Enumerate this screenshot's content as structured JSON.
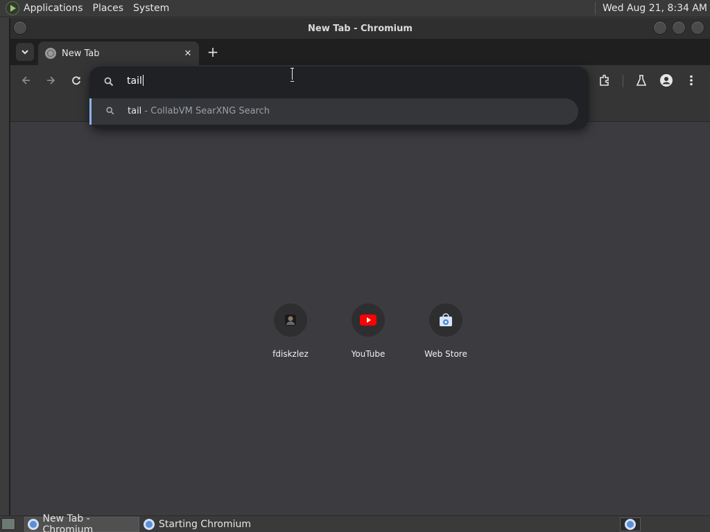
{
  "panel": {
    "menus": [
      "Applications",
      "Places",
      "System"
    ],
    "clock": "Wed Aug 21,  8:34 AM"
  },
  "window": {
    "title": "New Tab - Chromium"
  },
  "tabs": [
    {
      "title": "New Tab",
      "close": "✕"
    }
  ],
  "new_tab_symbol": "+",
  "omnibox": {
    "input": "tail",
    "suggestion": {
      "query": "tail",
      "description": " - CollabVM SearXNG Search"
    }
  },
  "shortcuts": [
    {
      "label": "fdiskzlez",
      "icon": "avatar-icon"
    },
    {
      "label": "YouTube",
      "icon": "youtube-icon"
    },
    {
      "label": "Web Store",
      "icon": "webstore-icon"
    }
  ],
  "taskbar": {
    "tasks": [
      "New Tab - Chromium",
      "Starting Chromium"
    ]
  },
  "colors": {
    "accent": "#8ab4f8",
    "youtube_red": "#ff0000",
    "content_bg": "#3c3c40"
  }
}
